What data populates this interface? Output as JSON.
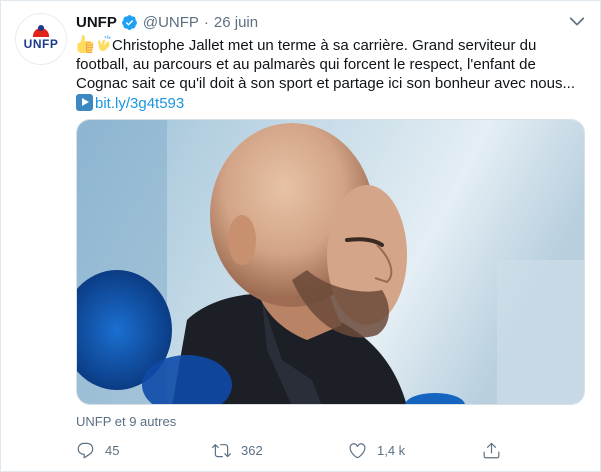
{
  "tweet": {
    "author_name": "UNFP",
    "author_handle": "@UNFP",
    "separator": "·",
    "date": "26 juin",
    "avatar_text": "UNFP",
    "text_line1": "Christophe Jallet met un terme à sa carrière. Grand serviteur du",
    "text_line2": "football, au parcours et au palmarès qui forcent le respect, l'enfant de",
    "text_line3": "Cognac sait ce qu'il doit à son sport et partage ici son bonheur avec nous...",
    "link_text": "bit.ly/3g4t593",
    "likers_text": "UNFP et 9 autres",
    "media_alt": "Christophe Jallet"
  },
  "actions": {
    "reply_count": "45",
    "retweet_count": "362",
    "like_count": "1,4 k"
  },
  "icons": {
    "verified": "verified-badge-icon",
    "caret": "chevron-down-icon",
    "reply": "reply-icon",
    "retweet": "retweet-icon",
    "like": "like-icon",
    "share": "share-icon"
  },
  "colors": {
    "link": "#1b95e0",
    "secondary_text": "#5b7083",
    "verified": "#1da1f2"
  }
}
